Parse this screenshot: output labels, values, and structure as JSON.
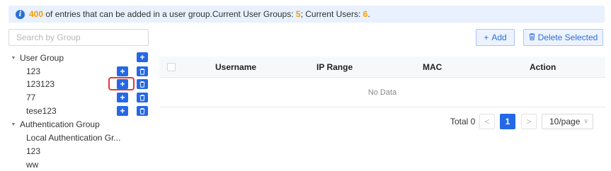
{
  "info": {
    "count": "400",
    "text1": " of entries that can be added in a user group.Current User Groups: ",
    "groups": "5",
    "text2": "; Current Users: ",
    "users": "6",
    "text3": "."
  },
  "search": {
    "placeholder": "Search by Group"
  },
  "tree": {
    "user_group": {
      "label": "User Group",
      "children": [
        "123",
        "123123",
        "77",
        "tese123"
      ]
    },
    "auth_group": {
      "label": "Authentication Group",
      "children": [
        "Local Authentication Gr...",
        "123",
        "ww"
      ]
    }
  },
  "toolbar": {
    "add_label": "Add",
    "delete_label": "Delete Selected"
  },
  "table": {
    "columns": [
      "Username",
      "IP Range",
      "MAC",
      "Action"
    ],
    "empty_text": "No Data"
  },
  "pagination": {
    "total_label": "Total 0",
    "prev": "<",
    "current_page": "1",
    "next": ">",
    "page_size": "10/page"
  },
  "colors": {
    "accent": "#2468e6",
    "highlight": "#f5a000",
    "focus": "#e53935"
  }
}
